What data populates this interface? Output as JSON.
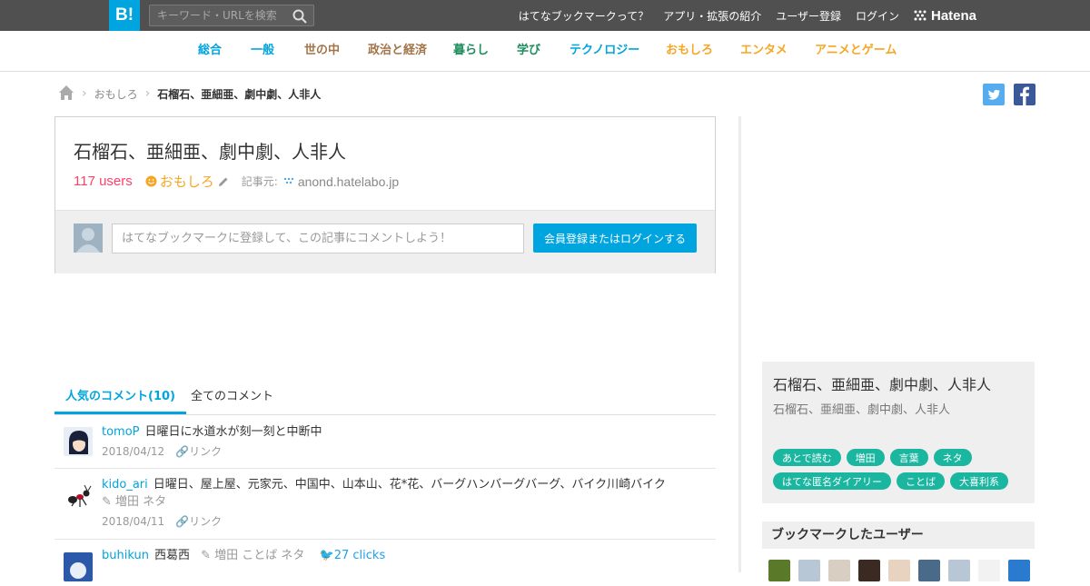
{
  "header": {
    "logo": "B!",
    "search_placeholder": "キーワード・URLを検索",
    "links": [
      "はてなブックマークって？",
      "アプリ・拡張の紹介",
      "ユーザー登録",
      "ログイン"
    ],
    "brand": "Hatena"
  },
  "categories": [
    {
      "label": "総合",
      "color": "#00a4de"
    },
    {
      "label": "一般",
      "color": "#00a4de"
    },
    {
      "label": "世の中",
      "color": "#a2744a"
    },
    {
      "label": "政治と経済",
      "color": "#a2744a"
    },
    {
      "label": "暮らし",
      "color": "#1d8d5e"
    },
    {
      "label": "学び",
      "color": "#1d8d5e"
    },
    {
      "label": "テクノロジー",
      "color": "#00a4de"
    },
    {
      "label": "おもしろ",
      "color": "#f5a623"
    },
    {
      "label": "エンタメ",
      "color": "#f5a623"
    },
    {
      "label": "アニメとゲーム",
      "color": "#f5a623"
    }
  ],
  "breadcrumb": {
    "category": "おもしろ",
    "current": "石榴石、亜細亜、劇中劇、人非人"
  },
  "article": {
    "title": "石榴石、亜細亜、劇中劇、人非人",
    "users": "117 users",
    "category": "おもしろ",
    "source_label": "記事元:",
    "domain": "anond.hatelabo.jp"
  },
  "comment_box": {
    "placeholder": "はてなブックマークに登録して、この記事にコメントしよう！",
    "button": "会員登録またはログインする"
  },
  "tabs": {
    "popular": "人気のコメント(10)",
    "all": "全てのコメント"
  },
  "comments": [
    {
      "user": "tomoP",
      "text": "日曜日に水道水が刻一刻と中断中",
      "tags": "",
      "date": "2018/04/12",
      "link": "リンク"
    },
    {
      "user": "kido_ari",
      "text": "日曜日、屋上屋、元家元、中国中、山本山、花*花、バーグハンバーグバーグ、バイク川崎バイク",
      "tags": "増田 ネタ",
      "date": "2018/04/11",
      "link": "リンク"
    },
    {
      "user": "buhikun",
      "text": "西葛西",
      "tags": "増田 ことば ネタ",
      "clicks": "27 clicks"
    }
  ],
  "sidebar": {
    "title": "石榴石、亜細亜、劇中劇、人非人",
    "subtitle": "石榴石、亜細亜、劇中劇、人非人",
    "tags": [
      "あとで読む",
      "増田",
      "言葉",
      "ネタ",
      "はてな匿名ダイアリー",
      "ことば",
      "大喜利系"
    ],
    "users_heading": "ブックマークしたユーザー"
  },
  "colors": {
    "accent": "#00a4de",
    "users": "#ff4166",
    "tag": "#1bb69f",
    "topbar": "#505050"
  }
}
